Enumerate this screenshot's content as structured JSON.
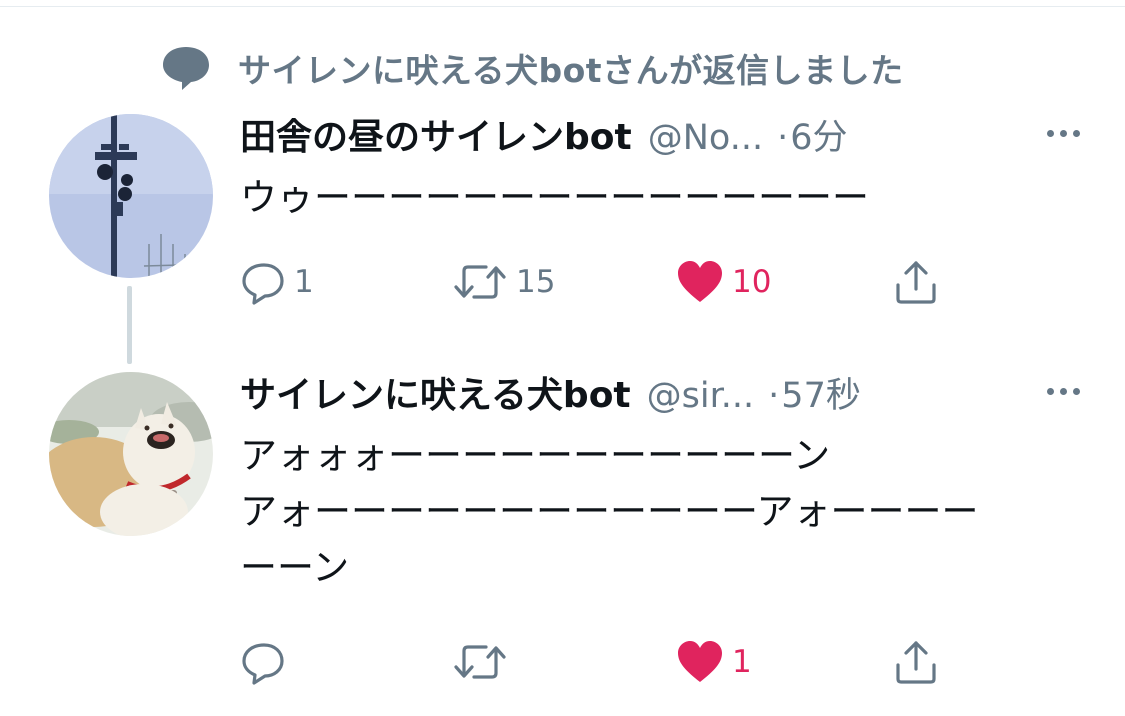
{
  "context": {
    "icon": "reply-bubble-icon",
    "text": "サイレンに吠える犬botさんが返信しました"
  },
  "tweets": [
    {
      "name": "田舎の昼のサイレンbot",
      "handle": "@No...",
      "separator": "·",
      "time": "6分",
      "text": "ウゥーーーーーーーーーーーーーーー",
      "reply_count": "1",
      "retweet_count": "15",
      "like_count": "10",
      "liked": true
    },
    {
      "name": "サイレンに吠える犬bot",
      "handle": "@sir...",
      "separator": "·",
      "time": "57秒",
      "text": "アォォォーーーーーーーーーーーン\nアォーーーーーーーーーーーーアォーーーー\nーーン",
      "reply_count": "",
      "retweet_count": "",
      "like_count": "1",
      "liked": true
    }
  ],
  "colors": {
    "secondary": "#657786",
    "like": "#e0245e",
    "text": "#0f1419"
  }
}
